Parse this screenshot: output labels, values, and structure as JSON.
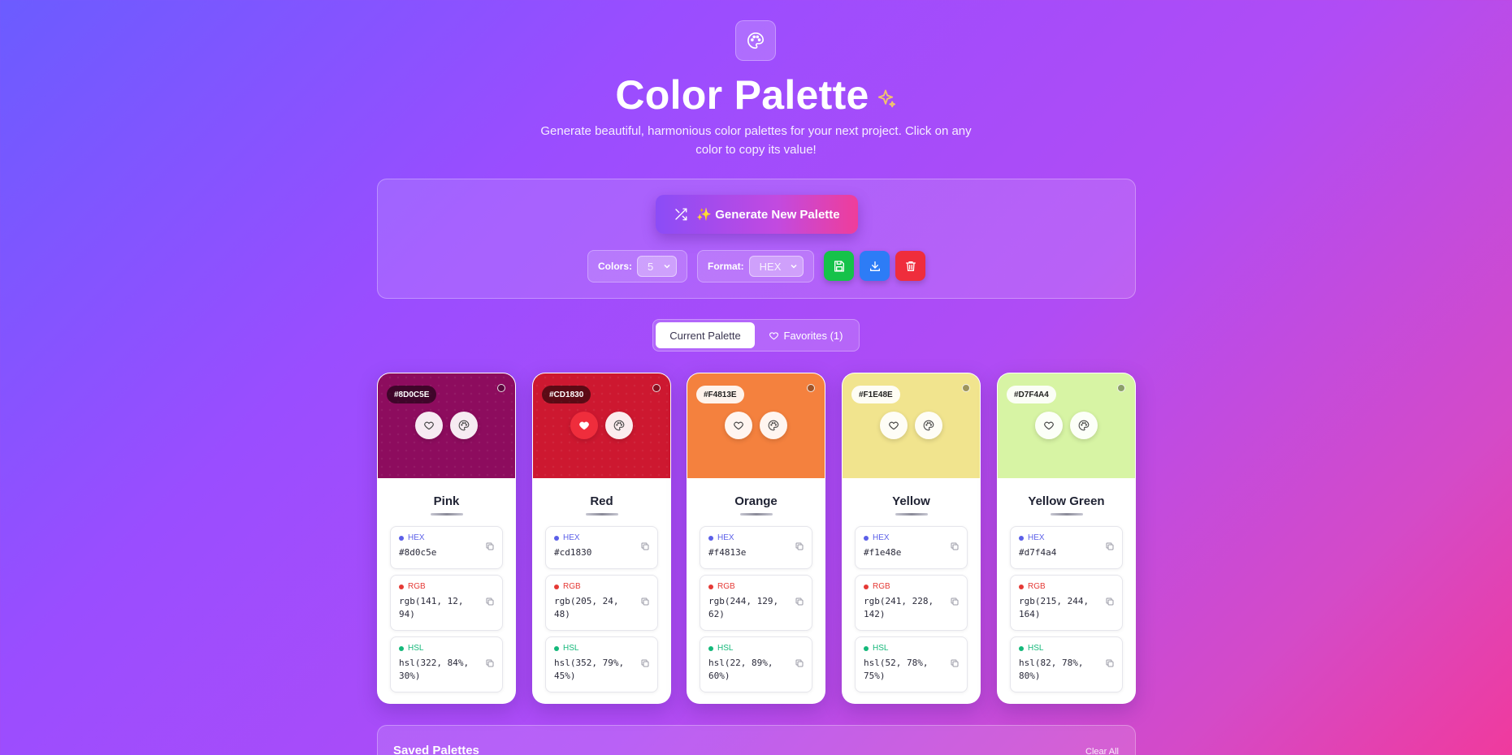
{
  "header": {
    "title": "Color Palette",
    "subtitle": "Generate beautiful, harmonious color palettes for your next project. Click on any color to copy its value!"
  },
  "controls": {
    "generate_label": "✨ Generate New Palette",
    "colors_label": "Colors:",
    "colors_value": "5",
    "format_label": "Format:",
    "format_value": "HEX"
  },
  "tabs": {
    "current": "Current Palette",
    "favorites": "Favorites (1)"
  },
  "labels": {
    "hex": "HEX",
    "rgb": "RGB",
    "hsl": "HSL"
  },
  "colors": [
    {
      "badge": "#8D0C5E",
      "name": "Pink",
      "hex": "#8d0c5e",
      "rgb": "rgb(141, 12, 94)",
      "hsl": "hsl(322, 84%, 30%)",
      "swatch": "#8d0c5e",
      "favorite": false
    },
    {
      "badge": "#CD1830",
      "name": "Red",
      "hex": "#cd1830",
      "rgb": "rgb(205, 24, 48)",
      "hsl": "hsl(352, 79%, 45%)",
      "swatch": "#cd1830",
      "favorite": true
    },
    {
      "badge": "#F4813E",
      "name": "Orange",
      "hex": "#f4813e",
      "rgb": "rgb(244, 129, 62)",
      "hsl": "hsl(22, 89%, 60%)",
      "swatch": "#f4813e",
      "favorite": false
    },
    {
      "badge": "#F1E48E",
      "name": "Yellow",
      "hex": "#f1e48e",
      "rgb": "rgb(241, 228, 142)",
      "hsl": "hsl(52, 78%, 75%)",
      "swatch": "#f1e48e",
      "favorite": false
    },
    {
      "badge": "#D7F4A4",
      "name": "Yellow Green",
      "hex": "#d7f4a4",
      "rgb": "rgb(215, 244, 164)",
      "hsl": "hsl(82, 78%, 80%)",
      "swatch": "#d7f4a4",
      "favorite": false
    }
  ],
  "saved": {
    "title": "Saved Palettes",
    "clear_label": "Clear All"
  },
  "accent_colors": {
    "save": "#16c24a",
    "download": "#2d7cf6",
    "delete": "#ef2d3c",
    "hex_dot": "#5b5fe8",
    "rgb_dot": "#e53935",
    "hsl_dot": "#14b87a"
  }
}
